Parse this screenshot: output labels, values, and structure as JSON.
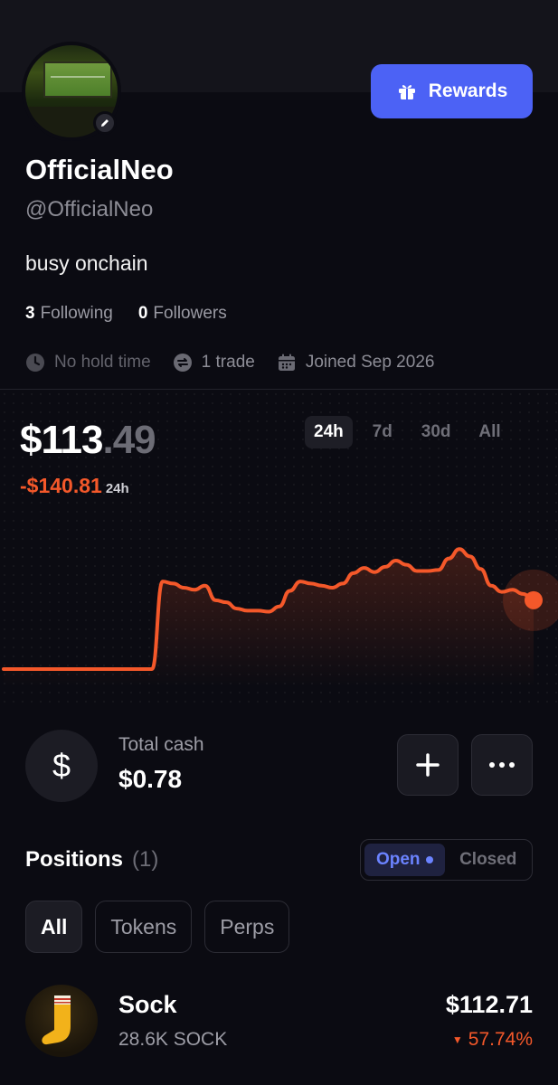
{
  "profile": {
    "display_name": "OfficialNeo",
    "handle": "@OfficialNeo",
    "bio": "busy onchain",
    "following_count": "3",
    "following_label": "Following",
    "followers_count": "0",
    "followers_label": "Followers",
    "meta": {
      "hold_time": "No hold time",
      "trades": "1 trade",
      "joined": "Joined Sep 2026"
    }
  },
  "rewards_button": {
    "label": "Rewards",
    "color": "#4c62f5"
  },
  "portfolio": {
    "balance_whole": "$113",
    "balance_cents": ".49",
    "change": "-$140.81",
    "change_period": "24h",
    "range_tabs": [
      "24h",
      "7d",
      "30d",
      "All"
    ],
    "active_range": "24h",
    "accent_color": "#f4582a"
  },
  "chart_data": {
    "type": "line",
    "title": "",
    "xlabel": "",
    "ylabel": "",
    "x": [
      0,
      1,
      2,
      3,
      4,
      5,
      6,
      7,
      8,
      9,
      10,
      11,
      12,
      13,
      14,
      15,
      16,
      17,
      18,
      19,
      20,
      21,
      22,
      23,
      24,
      25,
      26,
      27,
      28,
      29,
      30,
      31,
      32,
      33,
      34,
      35,
      36,
      37,
      38,
      39,
      40,
      41,
      42,
      43,
      44,
      45,
      46,
      47,
      48,
      49,
      50
    ],
    "values": [
      0,
      0,
      0,
      0,
      0,
      0,
      0,
      0,
      0,
      0,
      0,
      0,
      0,
      0,
      0,
      84,
      82,
      78,
      76,
      80,
      66,
      64,
      58,
      56,
      56,
      55,
      60,
      75,
      84,
      82,
      80,
      78,
      82,
      92,
      97,
      93,
      98,
      104,
      100,
      94,
      94,
      95,
      106,
      115,
      108,
      96,
      80,
      74,
      76,
      72,
      66
    ],
    "ylim": [
      0,
      130
    ],
    "grid": false,
    "legend": "none"
  },
  "cash": {
    "label": "Total cash",
    "value": "$0.78",
    "icon": "dollar-icon"
  },
  "positions": {
    "title": "Positions",
    "count": "(1)",
    "toggle": {
      "open": "Open",
      "closed": "Closed",
      "active": "open"
    },
    "filters": [
      "All",
      "Tokens",
      "Perps"
    ],
    "active_filter": "All",
    "items": [
      {
        "name": "Sock",
        "amount": "28.6K SOCK",
        "value": "$112.71",
        "change": "57.74%",
        "direction": "down"
      }
    ]
  }
}
